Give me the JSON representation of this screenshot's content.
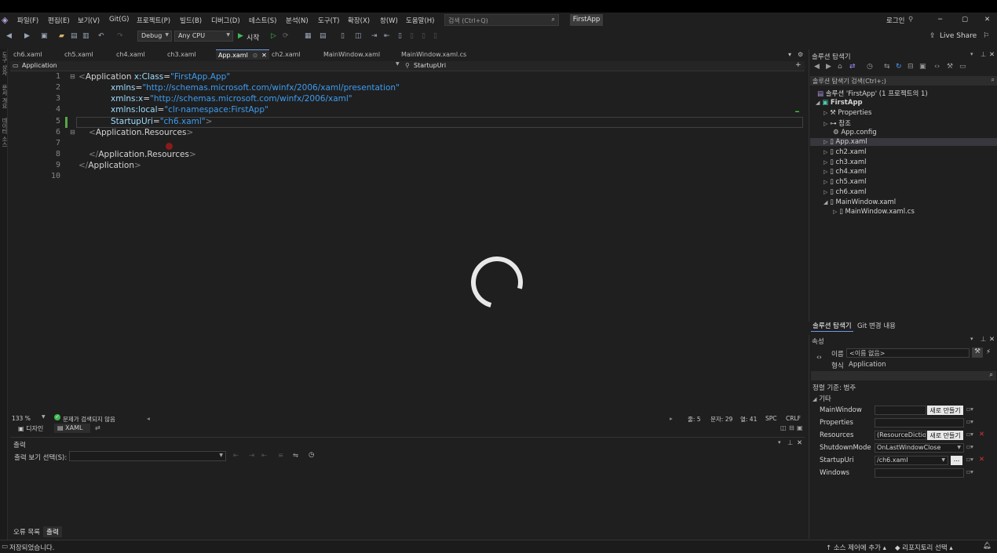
{
  "window": {
    "app_logo": "visual-studio-icon",
    "project_name": "FirstApp",
    "login": "로그인"
  },
  "menu": [
    "파일(F)",
    "편집(E)",
    "보기(V)",
    "Git(G)",
    "프로젝트(P)",
    "빌드(B)",
    "디버그(D)",
    "테스트(S)",
    "분석(N)",
    "도구(T)",
    "확장(X)",
    "창(W)",
    "도움말(H)"
  ],
  "search": {
    "placeholder": "검색 (Ctrl+Q)"
  },
  "toolbar": {
    "config": "Debug",
    "platform": "Any CPU",
    "start": "시작",
    "live_share": "Live Share"
  },
  "tabs": [
    "ch6.xaml",
    "ch5.xaml",
    "ch4.xaml",
    "ch3.xaml",
    "App.xaml",
    "ch2.xaml",
    "MainWindow.xaml",
    "MainWindow.xaml.cs"
  ],
  "active_tab": "App.xaml",
  "navbar": {
    "left": "Application",
    "right": "StartupUri"
  },
  "left_strip": [
    "도구 상자",
    "문서 개요",
    "데이터 소스"
  ],
  "code": {
    "line_numbers": [
      "1",
      "2",
      "3",
      "4",
      "5",
      "6",
      "7",
      "8",
      "9",
      "10"
    ],
    "l1_tag": "Application",
    "l1_attr": "x:Class",
    "l1_val": "\"FirstApp.App\"",
    "l2_attr": "xmlns",
    "l2_val": "\"http://schemas.microsoft.com/winfx/2006/xaml/presentation\"",
    "l3_attr": "xmlns:x",
    "l3_val": "\"http://schemas.microsoft.com/winfx/2006/xaml\"",
    "l4_attr": "xmlns:local",
    "l4_val": "\"clr-namespace:FirstApp\"",
    "l5_attr": "StartupUri",
    "l5_val": "\"ch6.xaml\"",
    "l6_tag": "Application.Resources",
    "l8_tag": "Application.Resources",
    "l9_tag": "Application"
  },
  "status_row": {
    "zoom": "133 %",
    "issues": "문제가 검색되지 않음",
    "line": "줄: 5",
    "char": "문자: 29",
    "col": "열: 41",
    "spc": "SPC",
    "crlf": "CRLF"
  },
  "view_tabs": {
    "design": "디자인",
    "xaml": "XAML"
  },
  "output": {
    "title": "출력",
    "source_label": "출력 보기 선택(S):"
  },
  "bottom_tabs": [
    "오류 목록",
    "출력"
  ],
  "statusbar": {
    "saved": "저장되었습니다.",
    "source_control": "소스 제어에 추가",
    "repo": "리포지토리 선택"
  },
  "solution_explorer": {
    "title": "솔루션 탐색기",
    "search_placeholder": "솔루션 탐색기 검색(Ctrl+;)",
    "solution": "솔루션 'FirstApp' (1 프로젝트의 1)",
    "project": "FirstApp",
    "items": [
      "Properties",
      "참조",
      "App.config",
      "App.xaml",
      "ch2.xaml",
      "ch3.xaml",
      "ch4.xaml",
      "ch5.xaml",
      "ch6.xaml",
      "MainWindow.xaml",
      "MainWindow.xaml.cs"
    ],
    "bottom_tabs": [
      "솔루션 탐색기",
      "Git 변경 내용"
    ]
  },
  "properties": {
    "title": "속성",
    "name_label": "이름",
    "name_value": "<이름 없음>",
    "type_label": "형식",
    "type_value": "Application",
    "sort": "정렬 기준: 범주",
    "category": "기타",
    "rows": [
      {
        "name": "MainWindow",
        "value": "",
        "button": "새로 만들기"
      },
      {
        "name": "Properties",
        "value": "",
        "button": ""
      },
      {
        "name": "Resources",
        "value": "(ResourceDictio...",
        "button": "새로 만들기"
      },
      {
        "name": "ShutdownMode",
        "value": "OnLastWindowClose",
        "button": ""
      },
      {
        "name": "StartupUri",
        "value": "/ch6.xaml",
        "button": "..."
      },
      {
        "name": "Windows",
        "value": "",
        "button": ""
      }
    ]
  },
  "colors": {
    "accent": "#6e9ae0",
    "bg": "#1f1f1f",
    "string": "#3d9cf0",
    "attr": "#9cdcfe"
  }
}
